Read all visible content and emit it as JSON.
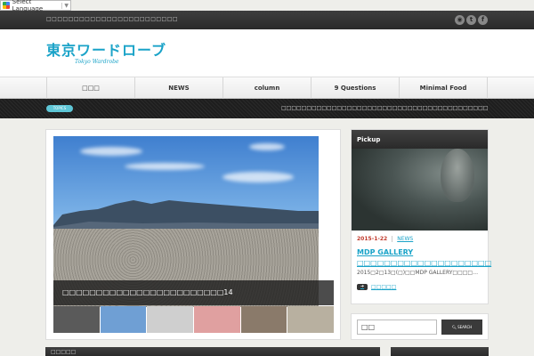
{
  "language_selector": {
    "label": "Select Language"
  },
  "topbar": {
    "tagline": "□□□□□□□□□□□□□□□□□□□□□□□□"
  },
  "header": {
    "logo": "東京ワードローブ",
    "logo_sub": "Tokyo Wardrobe"
  },
  "nav": {
    "items": [
      {
        "label": "□□□"
      },
      {
        "label": "NEWS"
      },
      {
        "label": "column"
      },
      {
        "label": "9 Questions"
      },
      {
        "label": "Minimal Food"
      }
    ]
  },
  "topics": {
    "badge": "TOPICS",
    "text": "□□□□□□□□□□□□□□□□□□□□□□□□□□□□□□□□□□□□□□□□□□□□□□□□□□□□□□□□□□□□"
  },
  "slider": {
    "caption": "□□□□□□□□□□□□□□□□□□□□□□□□14",
    "thumbs": [
      "#5a5a5a",
      "#6f9fd4",
      "#cfcfcf",
      "#e0a0a0",
      "#8a7a6a",
      "#b8b0a0"
    ]
  },
  "pickup": {
    "title": "Pickup",
    "date": "2015-1-22",
    "category": "NEWS",
    "headline": "MDP GALLERY □□□□□□□□□□□□□□□□□□□□",
    "excerpt": "2015□2□13□(□)□□MDP GALLERY□□□□…",
    "more": "□□□□□"
  },
  "search": {
    "value": "□□",
    "button": "SEARCH"
  },
  "bottom": {
    "left": "□□□□□"
  }
}
